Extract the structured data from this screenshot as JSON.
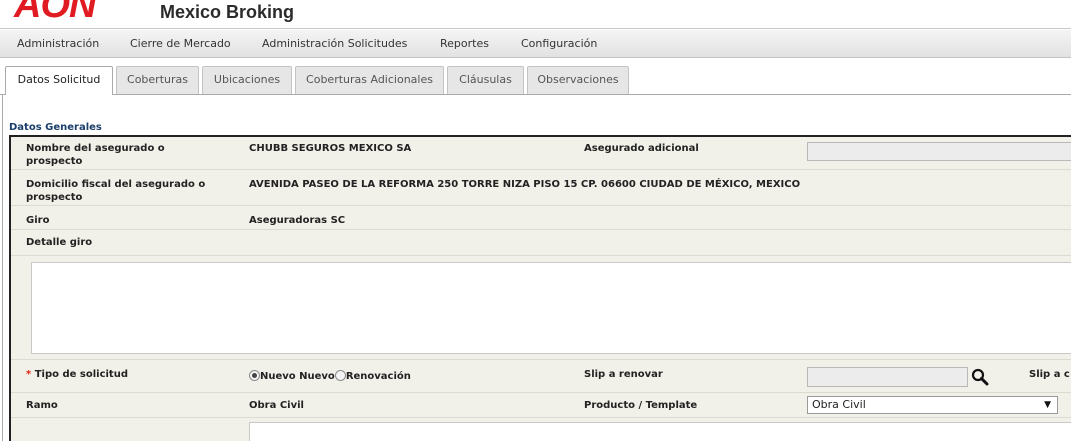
{
  "header": {
    "logo_text": "AON",
    "app_title": "Mexico Broking"
  },
  "menu": [
    {
      "label": "Administración"
    },
    {
      "label": "Cierre de Mercado"
    },
    {
      "label": "Administración Solicitudes"
    },
    {
      "label": "Reportes"
    },
    {
      "label": "Configuración"
    }
  ],
  "tabs": [
    {
      "label": "Datos Solicitud",
      "active": true
    },
    {
      "label": "Coberturas"
    },
    {
      "label": "Ubicaciones"
    },
    {
      "label": "Coberturas Adicionales"
    },
    {
      "label": "Cláusulas"
    },
    {
      "label": "Observaciones"
    }
  ],
  "section": {
    "title": "Datos Generales"
  },
  "form": {
    "nombre_label": "Nombre del asegurado o prospecto",
    "nombre_value": "CHUBB SEGUROS MEXICO SA",
    "asegurado_adicional_label": "Asegurado adicional",
    "asegurado_adicional_value": "",
    "domicilio_label": "Domicilio fiscal del asegurado o prospecto",
    "domicilio_value": "AVENIDA PASEO DE LA REFORMA 250 TORRE NIZA PISO 15 CP. 06600 CIUDAD DE MÉXICO, MEXICO",
    "giro_label": "Giro",
    "giro_value": "Aseguradoras SC",
    "detalle_giro_label": "Detalle giro",
    "detalle_giro_value": "",
    "required_mark": "*",
    "tipo_label": "Tipo de solicitud",
    "tipo_options": [
      {
        "label": "Nuevo Nuevo",
        "checked": true
      },
      {
        "label": "Renovación",
        "checked": false
      }
    ],
    "slip_renovar_label": "Slip a renovar",
    "slip_renovar_value": "",
    "slip_a_label": "Slip a c",
    "ramo_label": "Ramo",
    "ramo_value": "Obra Civil",
    "producto_label": "Producto / Template",
    "producto_selected": "Obra Civil",
    "dropdown_arrow": "▼"
  },
  "colors": {
    "brand": "#e11b22",
    "section_title": "#1b3e6b",
    "form_background": "#f2f1e9"
  },
  "icons": {
    "search": "search-icon"
  }
}
